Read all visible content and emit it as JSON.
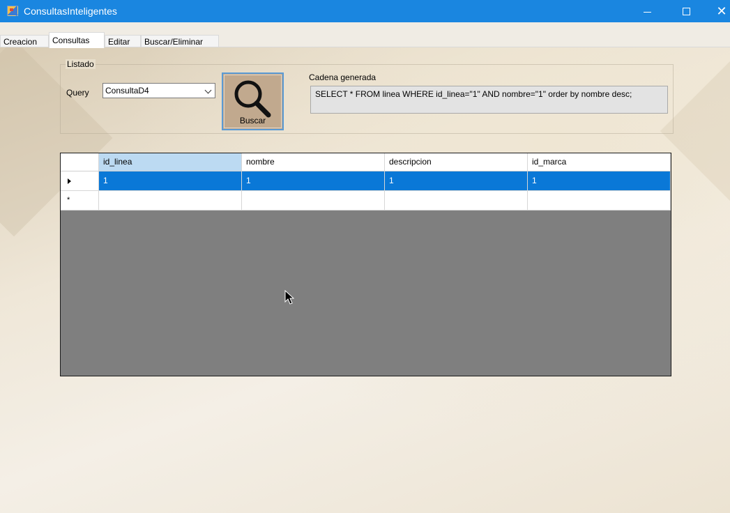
{
  "window": {
    "title": "ConsultasInteligentes",
    "close_glyph": "✕"
  },
  "tabs": [
    {
      "label": "Creacion",
      "active": false
    },
    {
      "label": "Consultas",
      "active": true
    },
    {
      "label": "Editar",
      "active": false
    },
    {
      "label": "Buscar/Eliminar",
      "active": false
    }
  ],
  "listado": {
    "group_title": "Listado",
    "query_label": "Query",
    "query_value": "ConsultaD4"
  },
  "buscar": {
    "label": "Buscar",
    "icon": "magnifier-icon"
  },
  "cadena": {
    "label": "Cadena generada",
    "value": "SELECT  * FROM linea  WHERE id_linea=\"1\"  AND nombre=\"1\"  order by nombre desc;"
  },
  "grid": {
    "columns": [
      "id_linea",
      "nombre",
      "descripcion",
      "id_marca"
    ],
    "rows": [
      [
        "1",
        "1",
        "1",
        "1"
      ]
    ],
    "new_row_marker": "*"
  },
  "colors": {
    "titlebar": "#1a86e0",
    "selected_row": "#0a78d7",
    "grid_empty": "#7f7f7f"
  }
}
